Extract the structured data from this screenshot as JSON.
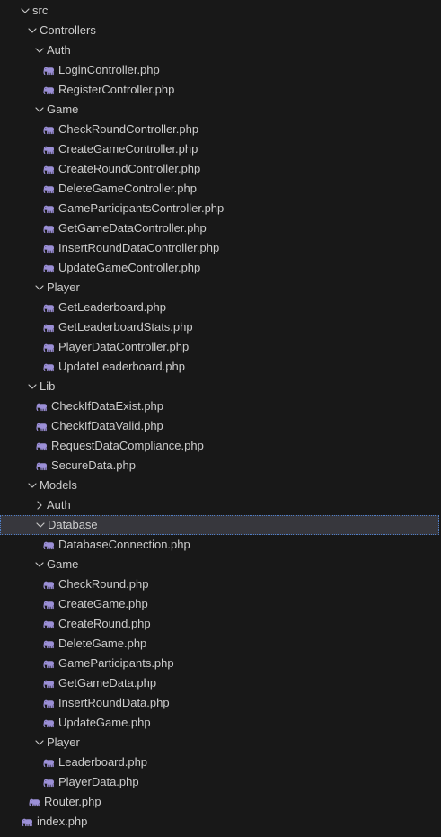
{
  "explorer": {
    "items": [
      {
        "label": "src",
        "type": "folder",
        "depth": 0,
        "expanded": true
      },
      {
        "label": "Controllers",
        "type": "folder",
        "depth": 1,
        "expanded": true
      },
      {
        "label": "Auth",
        "type": "folder",
        "depth": 2,
        "expanded": true
      },
      {
        "label": "LoginController.php",
        "type": "file",
        "depth": 3,
        "icon": "php-elephant-icon"
      },
      {
        "label": "RegisterController.php",
        "type": "file",
        "depth": 3,
        "icon": "php-elephant-icon"
      },
      {
        "label": "Game",
        "type": "folder",
        "depth": 2,
        "expanded": true
      },
      {
        "label": "CheckRoundController.php",
        "type": "file",
        "depth": 3,
        "icon": "php-elephant-icon"
      },
      {
        "label": "CreateGameController.php",
        "type": "file",
        "depth": 3,
        "icon": "php-elephant-icon"
      },
      {
        "label": "CreateRoundController.php",
        "type": "file",
        "depth": 3,
        "icon": "php-elephant-icon"
      },
      {
        "label": "DeleteGameController.php",
        "type": "file",
        "depth": 3,
        "icon": "php-elephant-icon"
      },
      {
        "label": "GameParticipantsController.php",
        "type": "file",
        "depth": 3,
        "icon": "php-elephant-icon"
      },
      {
        "label": "GetGameDataController.php",
        "type": "file",
        "depth": 3,
        "icon": "php-elephant-icon"
      },
      {
        "label": "InsertRoundDataController.php",
        "type": "file",
        "depth": 3,
        "icon": "php-elephant-icon"
      },
      {
        "label": "UpdateGameController.php",
        "type": "file",
        "depth": 3,
        "icon": "php-elephant-icon"
      },
      {
        "label": "Player",
        "type": "folder",
        "depth": 2,
        "expanded": true
      },
      {
        "label": "GetLeaderboard.php",
        "type": "file",
        "depth": 3,
        "icon": "php-elephant-icon"
      },
      {
        "label": "GetLeaderboardStats.php",
        "type": "file",
        "depth": 3,
        "icon": "php-elephant-icon"
      },
      {
        "label": "PlayerDataController.php",
        "type": "file",
        "depth": 3,
        "icon": "php-elephant-icon"
      },
      {
        "label": "UpdateLeaderboard.php",
        "type": "file",
        "depth": 3,
        "icon": "php-elephant-icon"
      },
      {
        "label": "Lib",
        "type": "folder",
        "depth": 1,
        "expanded": true
      },
      {
        "label": "CheckIfDataExist.php",
        "type": "file",
        "depth": 2,
        "icon": "php-elephant-icon"
      },
      {
        "label": "CheckIfDataValid.php",
        "type": "file",
        "depth": 2,
        "icon": "php-elephant-icon"
      },
      {
        "label": "RequestDataCompliance.php",
        "type": "file",
        "depth": 2,
        "icon": "php-elephant-icon"
      },
      {
        "label": "SecureData.php",
        "type": "file",
        "depth": 2,
        "icon": "php-elephant-icon"
      },
      {
        "label": "Models",
        "type": "folder",
        "depth": 1,
        "expanded": true
      },
      {
        "label": "Auth",
        "type": "folder",
        "depth": 2,
        "expanded": false
      },
      {
        "label": "Database",
        "type": "folder",
        "depth": 2,
        "expanded": true,
        "selected": true
      },
      {
        "label": "DatabaseConnection.php",
        "type": "file",
        "depth": 3,
        "icon": "php-elephant-icon",
        "guide": true
      },
      {
        "label": "Game",
        "type": "folder",
        "depth": 2,
        "expanded": true
      },
      {
        "label": "CheckRound.php",
        "type": "file",
        "depth": 3,
        "icon": "php-elephant-icon"
      },
      {
        "label": "CreateGame.php",
        "type": "file",
        "depth": 3,
        "icon": "php-elephant-icon"
      },
      {
        "label": "CreateRound.php",
        "type": "file",
        "depth": 3,
        "icon": "php-elephant-icon"
      },
      {
        "label": "DeleteGame.php",
        "type": "file",
        "depth": 3,
        "icon": "php-elephant-icon"
      },
      {
        "label": "GameParticipants.php",
        "type": "file",
        "depth": 3,
        "icon": "php-elephant-icon"
      },
      {
        "label": "GetGameData.php",
        "type": "file",
        "depth": 3,
        "icon": "php-elephant-icon"
      },
      {
        "label": "InsertRoundData.php",
        "type": "file",
        "depth": 3,
        "icon": "php-elephant-icon"
      },
      {
        "label": "UpdateGame.php",
        "type": "file",
        "depth": 3,
        "icon": "php-elephant-icon"
      },
      {
        "label": "Player",
        "type": "folder",
        "depth": 2,
        "expanded": true
      },
      {
        "label": "Leaderboard.php",
        "type": "file",
        "depth": 3,
        "icon": "php-elephant-icon"
      },
      {
        "label": "PlayerData.php",
        "type": "file",
        "depth": 3,
        "icon": "php-elephant-icon"
      },
      {
        "label": "Router.php",
        "type": "file",
        "depth": 1,
        "icon": "php-elephant-icon"
      },
      {
        "label": "index.php",
        "type": "file",
        "depth": 0,
        "icon": "php-elephant-icon"
      }
    ]
  },
  "colors": {
    "background": "#181818",
    "text": "#cccccc",
    "chevron": "#c5c5c5",
    "php_icon": "#9b8fd6",
    "selected_background": "#37373d",
    "selected_border": "#4f7ec8"
  }
}
